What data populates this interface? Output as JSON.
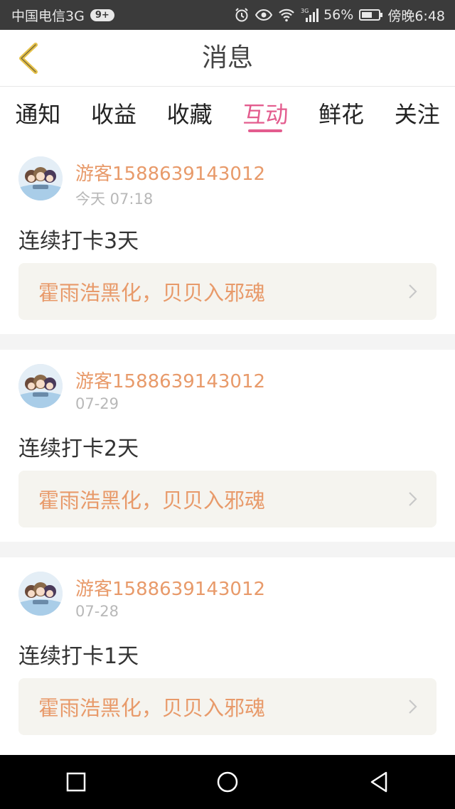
{
  "status_bar": {
    "carrier": "中国电信3G",
    "badge": "9+",
    "network_label": "3G",
    "battery": "56%",
    "time": "傍晚6:48",
    "icons": [
      "alarm-icon",
      "eye-icon",
      "wifi-icon",
      "signal-icon",
      "battery-icon"
    ]
  },
  "header": {
    "title": "消息",
    "back_icon": "chevron-left-icon"
  },
  "tabs": [
    {
      "label": "通知"
    },
    {
      "label": "收益"
    },
    {
      "label": "收藏"
    },
    {
      "label": "互动",
      "active": true
    },
    {
      "label": "鲜花"
    },
    {
      "label": "关注"
    }
  ],
  "feed": [
    {
      "username": "游客1588639143012",
      "time": "今天 07:18",
      "message": "连续打卡3天",
      "quote": "霍雨浩黑化，贝贝入邪魂"
    },
    {
      "username": "游客1588639143012",
      "time": "07-29",
      "message": "连续打卡2天",
      "quote": "霍雨浩黑化，贝贝入邪魂"
    },
    {
      "username": "游客1588639143012",
      "time": "07-28",
      "message": "连续打卡1天",
      "quote": "霍雨浩黑化，贝贝入邪魂"
    }
  ],
  "nav_bar": {
    "icons": [
      "square-icon",
      "circle-icon",
      "triangle-back-icon"
    ]
  },
  "colors": {
    "accent": "#e35c8e",
    "username": "#e89a6a",
    "status_bar_bg": "#3b3b3b",
    "back_icon": "#e6c24a"
  }
}
